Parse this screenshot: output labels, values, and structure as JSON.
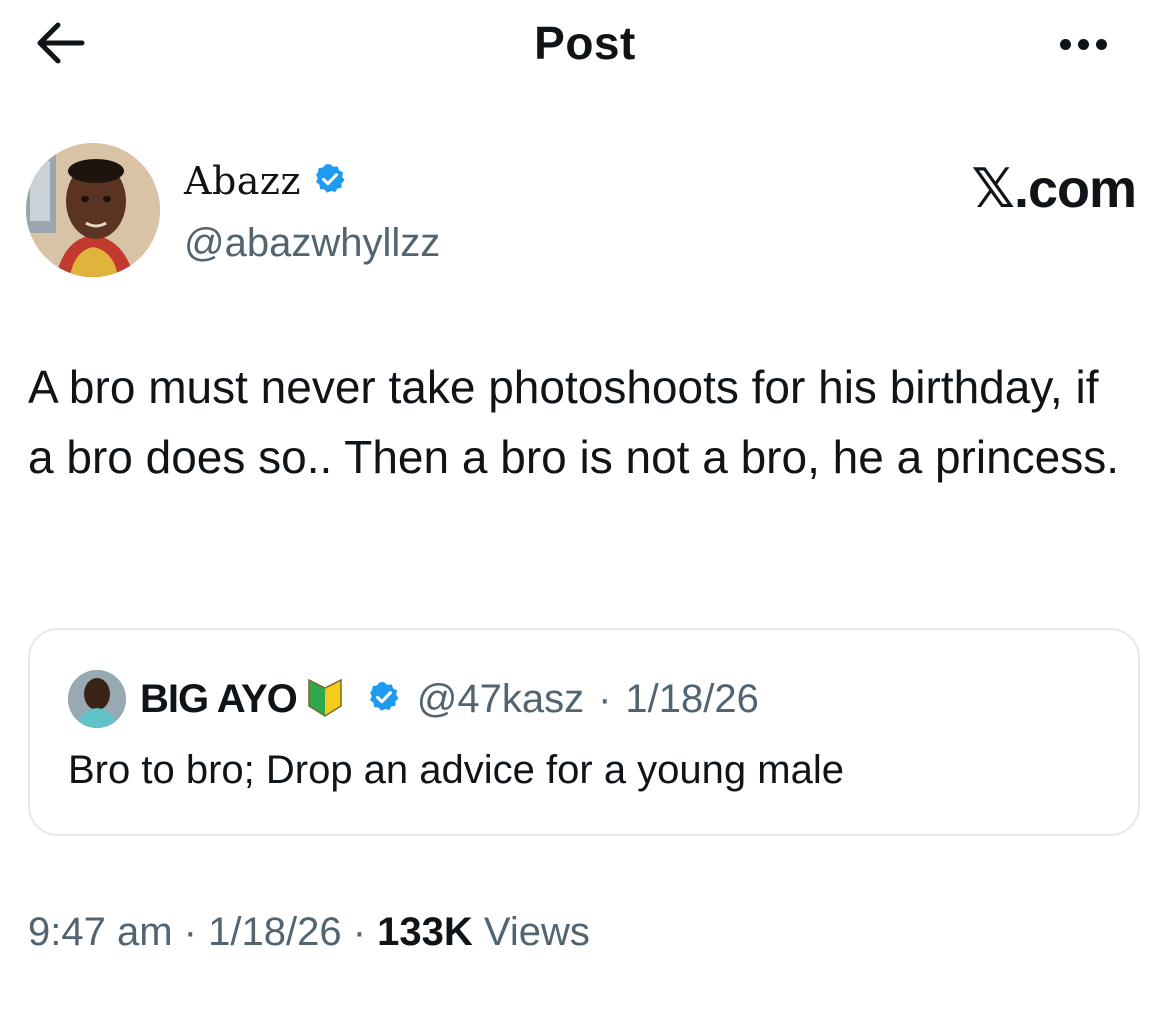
{
  "header": {
    "title": "Post",
    "back_icon": "arrow-left-icon",
    "more_icon": "more-horizontal-icon"
  },
  "author": {
    "name": "Abazz",
    "handle": "@abazwhyllzz",
    "verified_icon": "verified-badge-icon",
    "avatar_icon": "profile-photo"
  },
  "brand": {
    "label": "𝕏.com"
  },
  "post": {
    "text": "A bro must never take photoshoots for his birthday, if a bro does so.. Then a bro is not a bro, he a princess."
  },
  "quote": {
    "name": "BIG AYO",
    "badge_icon": "beginner-shield-emoji-icon",
    "verified_icon": "verified-badge-icon",
    "handle": "@47kasz",
    "separator": "·",
    "date": "1/18/26",
    "text": "Bro to bro; Drop an advice for a young male"
  },
  "footer": {
    "time": "9:47 am",
    "separator": "·",
    "date": "1/18/26",
    "views_count": "133K",
    "views_label": "Views"
  },
  "colors": {
    "text_primary": "#0f1419",
    "text_secondary": "#536471",
    "verified_blue": "#1d9bf0",
    "border": "#e6e9eb"
  }
}
